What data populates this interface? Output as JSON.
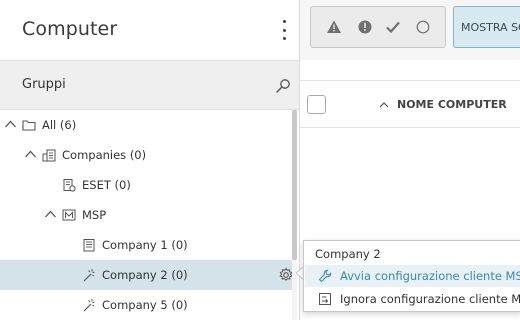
{
  "sidebar": {
    "title": "Computer",
    "groups_label": "Gruppi",
    "tree": [
      {
        "label": "All (6)",
        "icon": "folder-icon"
      },
      {
        "label": "Companies (0)",
        "icon": "companies-icon"
      },
      {
        "label": "ESET (0)",
        "icon": "company-icon"
      },
      {
        "label": "MSP",
        "icon": "msp-icon"
      },
      {
        "label": "Company 1 (0)",
        "icon": "building-icon"
      },
      {
        "label": "Company 2 (0)",
        "icon": "wand-icon"
      },
      {
        "label": "Company 5 (0)",
        "icon": "wand-icon"
      }
    ]
  },
  "toolbar": {
    "filters": [
      "warning-icon",
      "alert-icon",
      "check-icon",
      "circle-icon"
    ],
    "show_label": "MOSTRA SO"
  },
  "table": {
    "column_name": "NOME COMPUTER"
  },
  "context_menu": {
    "title": "Company 2",
    "items": [
      {
        "label": "Avvia configurazione cliente MSP",
        "icon": "wrench-icon"
      },
      {
        "label": "Ignora configurazione cliente MSP",
        "icon": "skip-icon"
      }
    ]
  },
  "colors": {
    "selected_row": "#d4e3ea",
    "accent_link": "#3a8ab3",
    "show_button_bg": "#d7eaf1"
  }
}
